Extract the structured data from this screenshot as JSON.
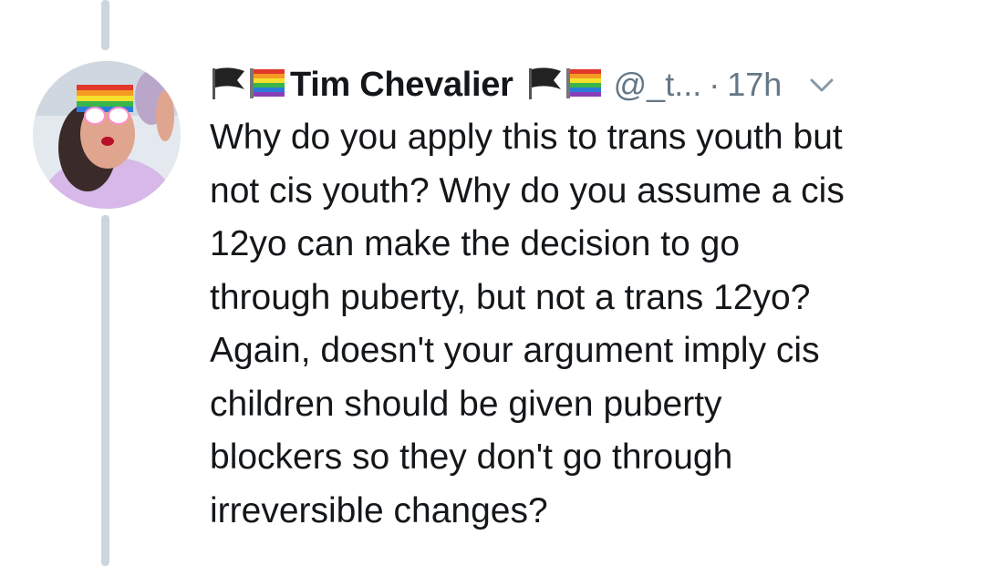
{
  "tweet": {
    "author_name": "Tim Chevalier",
    "handle": "@_t...",
    "separator": "·",
    "timestamp": "17h",
    "name_prefix_icons": [
      "black-flag-icon",
      "rainbow-flag-icon"
    ],
    "name_suffix_icons": [
      "black-flag-icon",
      "rainbow-flag-icon"
    ],
    "text_lines": [
      "Why do you apply this to trans youth but",
      "not cis youth? Why do you assume a cis",
      "12yo can make the decision to go",
      "through puberty, but not a trans 12yo?",
      "Again, doesn't your argument imply cis",
      "children should be given puberty",
      "blockers so they don't go through",
      "irreversible changes?"
    ]
  },
  "colors": {
    "background": "#ffffff",
    "text": "#14171a",
    "secondary_text": "#657786",
    "thread_line": "#ccd6dd"
  }
}
